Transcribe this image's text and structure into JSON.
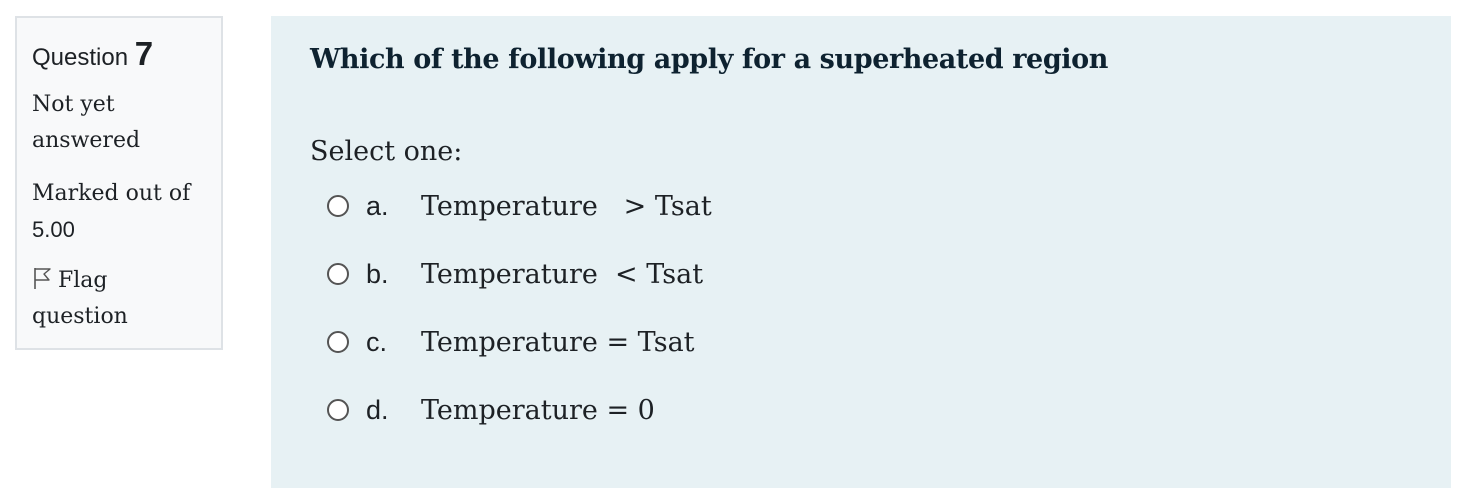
{
  "info": {
    "question_label": "Question",
    "question_number": "7",
    "state_line1": "Not yet",
    "state_line2": "answered",
    "grade_line1": "Marked out of",
    "grade_value": "5.00",
    "flag_line1": "Flag",
    "flag_line2": "question",
    "flag_icon": "flag-outline-icon"
  },
  "question": {
    "text": "Which of the following apply for a superheated region",
    "prompt": "Select one:",
    "answers": [
      {
        "letter": "a.",
        "text": "Temperature   > Tsat"
      },
      {
        "letter": "b.",
        "text": "Temperature  < Tsat"
      },
      {
        "letter": "c.",
        "text": "Temperature = Tsat"
      },
      {
        "letter": "d.",
        "text": "Temperature = 0"
      }
    ]
  },
  "colors": {
    "panel_bg": "#e7f1f4",
    "info_bg": "#f8f9fa",
    "info_border": "#dee2e6",
    "text": "#1d2125"
  }
}
